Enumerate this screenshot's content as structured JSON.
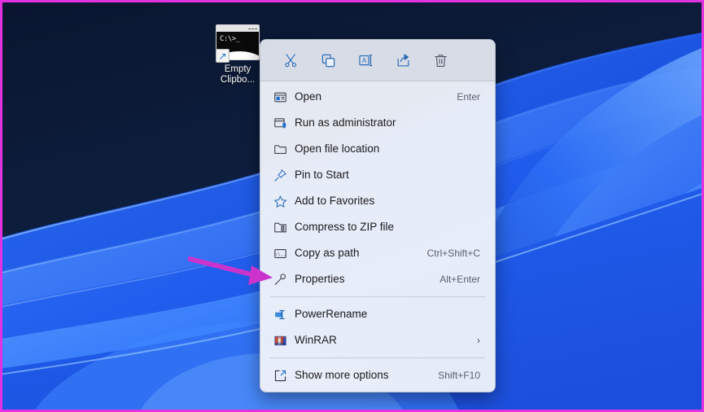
{
  "desktop": {
    "icon": {
      "name": "Empty Clipbo...",
      "terminal_text": "C:\\>_",
      "type": "command-prompt-shortcut"
    },
    "wallpaper": {
      "description": "Windows 11 Bloom blue ribbons on dark navy",
      "dark_navy": "#0c1a33",
      "ribbon_blue": "#2563e8",
      "ribbon_light": "#6ba8ff",
      "ribbon_bright": "#1f6bff"
    }
  },
  "annotation": {
    "arrow_color": "#cc33cc",
    "points_to": "Properties",
    "border_color": "#e231e2"
  },
  "context_menu": {
    "toolbar": [
      {
        "name": "cut",
        "label": "Cut",
        "icon": "scissors-icon"
      },
      {
        "name": "copy",
        "label": "Copy",
        "icon": "copy-icon"
      },
      {
        "name": "rename",
        "label": "Rename",
        "icon": "rename-icon"
      },
      {
        "name": "share",
        "label": "Share",
        "icon": "share-icon"
      },
      {
        "name": "delete",
        "label": "Delete",
        "icon": "trash-icon"
      }
    ],
    "items": [
      {
        "label": "Open",
        "accel": "Enter",
        "icon": "open-window-icon",
        "submenu": false
      },
      {
        "label": "Run as administrator",
        "accel": "",
        "icon": "shield-window-icon",
        "submenu": false
      },
      {
        "label": "Open file location",
        "accel": "",
        "icon": "folder-icon",
        "submenu": false
      },
      {
        "label": "Pin to Start",
        "accel": "",
        "icon": "pin-icon",
        "submenu": false
      },
      {
        "label": "Add to Favorites",
        "accel": "",
        "icon": "star-icon",
        "submenu": false
      },
      {
        "label": "Compress to ZIP file",
        "accel": "",
        "icon": "zip-folder-icon",
        "submenu": false
      },
      {
        "label": "Copy as path",
        "accel": "Ctrl+Shift+C",
        "icon": "copy-path-icon",
        "submenu": false
      },
      {
        "label": "Properties",
        "accel": "Alt+Enter",
        "icon": "wrench-icon",
        "submenu": false
      },
      {
        "label": "PowerRename",
        "accel": "",
        "icon": "powerrename-icon",
        "submenu": false
      },
      {
        "label": "WinRAR",
        "accel": "",
        "icon": "winrar-icon",
        "submenu": true
      },
      {
        "label": "Show more options",
        "accel": "Shift+F10",
        "icon": "expand-icon",
        "submenu": false
      }
    ],
    "separator_after_indices": [
      7,
      9
    ],
    "chevron": "›",
    "accent_color": "#1f6fd0",
    "background": "#eef1f9"
  }
}
